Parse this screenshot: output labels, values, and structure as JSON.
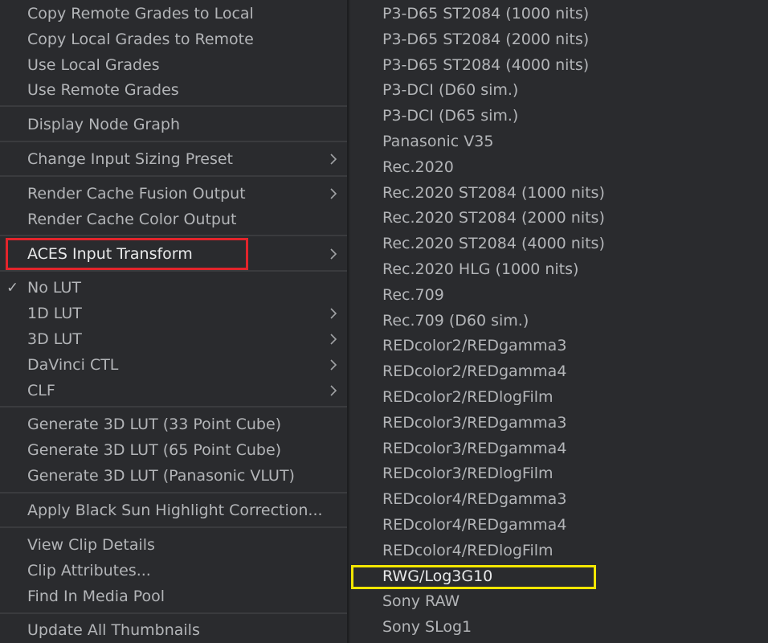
{
  "left_menu": {
    "items": [
      {
        "label": "Copy Remote Grades to Local"
      },
      {
        "label": "Copy Local Grades to Remote"
      },
      {
        "label": "Use Local Grades"
      },
      {
        "label": "Use Remote Grades"
      },
      {
        "label": "Display Node Graph"
      },
      {
        "label": "Change Input Sizing Preset"
      },
      {
        "label": "Render Cache Fusion Output"
      },
      {
        "label": "Render Cache Color Output"
      },
      {
        "label": "ACES Input Transform"
      },
      {
        "label": "No LUT"
      },
      {
        "label": "1D LUT"
      },
      {
        "label": "3D LUT"
      },
      {
        "label": "DaVinci CTL"
      },
      {
        "label": "CLF"
      },
      {
        "label": "Generate 3D LUT (33 Point Cube)"
      },
      {
        "label": "Generate 3D LUT (65 Point Cube)"
      },
      {
        "label": "Generate 3D LUT (Panasonic VLUT)"
      },
      {
        "label": "Apply Black Sun Highlight Correction..."
      },
      {
        "label": "View Clip Details"
      },
      {
        "label": "Clip Attributes..."
      },
      {
        "label": "Find In Media Pool"
      },
      {
        "label": "Update All Thumbnails"
      }
    ],
    "check_glyph": "✓"
  },
  "submenu": {
    "items": [
      {
        "label": "P3-D65 ST2084 (1000 nits)"
      },
      {
        "label": "P3-D65 ST2084 (2000 nits)"
      },
      {
        "label": "P3-D65 ST2084 (4000 nits)"
      },
      {
        "label": "P3-DCI (D60 sim.)"
      },
      {
        "label": "P3-DCI (D65 sim.)"
      },
      {
        "label": "Panasonic V35"
      },
      {
        "label": "Rec.2020"
      },
      {
        "label": "Rec.2020 ST2084 (1000 nits)"
      },
      {
        "label": "Rec.2020 ST2084 (2000 nits)"
      },
      {
        "label": "Rec.2020 ST2084 (4000 nits)"
      },
      {
        "label": "Rec.2020 HLG (1000 nits)"
      },
      {
        "label": "Rec.709"
      },
      {
        "label": "Rec.709 (D60 sim.)"
      },
      {
        "label": "REDcolor2/REDgamma3"
      },
      {
        "label": "REDcolor2/REDgamma4"
      },
      {
        "label": "REDcolor2/REDlogFilm"
      },
      {
        "label": "REDcolor3/REDgamma3"
      },
      {
        "label": "REDcolor3/REDgamma4"
      },
      {
        "label": "REDcolor3/REDlogFilm"
      },
      {
        "label": "REDcolor4/REDgamma3"
      },
      {
        "label": "REDcolor4/REDgamma4"
      },
      {
        "label": "REDcolor4/REDlogFilm"
      },
      {
        "label": "RWG/Log3G10"
      },
      {
        "label": "Sony RAW"
      },
      {
        "label": "Sony SLog1"
      }
    ]
  },
  "colors": {
    "menu_bg": "#2a2b2e",
    "text": "#b3b5b8",
    "separator": "#3a3b3e",
    "highlight_red": "#e2242b",
    "highlight_yellow": "#f2e600"
  }
}
